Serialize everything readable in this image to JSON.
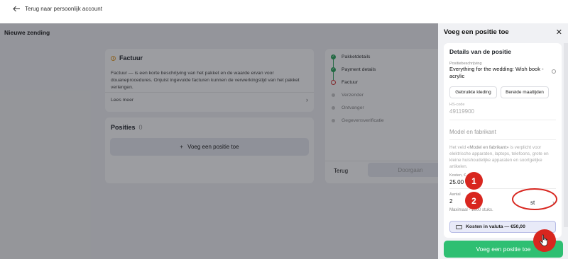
{
  "topbar": {
    "back_label": "Terug naar persoonlijk account"
  },
  "page": {
    "title": "Nieuwe zending"
  },
  "factuur": {
    "title": "Factuur",
    "description": "Factuur — is een korte beschrijving van het pakket en de waarde ervan voor douaneprocedures. Onjuist ingevulde facturen kunnen de verwerkingstijd van het pakket verlengen.",
    "read_more": "Lees meer"
  },
  "posities": {
    "title": "Posities",
    "count": "0",
    "add_label": "Voeg een positie toe"
  },
  "steps": {
    "items": [
      {
        "label": "Pakketdetails",
        "state": "done"
      },
      {
        "label": "Payment details",
        "state": "done"
      },
      {
        "label": "Factuur",
        "state": "current"
      },
      {
        "label": "Verzender",
        "state": "todo"
      },
      {
        "label": "Ontvanger",
        "state": "todo"
      },
      {
        "label": "Gegevensverificatie",
        "state": "todo"
      }
    ],
    "back_label": "Terug",
    "continue_label": "Doorgaan"
  },
  "panel": {
    "title": "Voeg een positie toe",
    "section_title": "Details van de positie",
    "description_label": "Positiebeschrijving",
    "description_value": "Everything for the wedding: Wish book - acrylic",
    "chips": [
      "Gebruikte kleding",
      "Bereide maaltijden"
    ],
    "hs_label": "HS-code",
    "hs_value": "49119900",
    "model_placeholder": "Model en fabrikant",
    "notice_prefix": "Het veld ",
    "notice_highlight": "«Model en fabrikant»",
    "notice_suffix": " is verplicht voor elektrische apparaten, laptops, telefoons, grote en kleine huishoudelijke apparaten en soortgelijke artikelen.",
    "cost_label": "Kosten, €",
    "cost_value": "25.00",
    "qty_label": "Aantal",
    "qty_value": "2",
    "unit_value": "st",
    "max_note": "Maximaal - 1000 stuks.",
    "currency_box": "Kosten in valuta — €50,00",
    "submit_label": "Voeg een positie toe"
  },
  "annotations": {
    "badge1": "1",
    "badge2": "2"
  },
  "colors": {
    "accent_green": "#2ebf72",
    "annotation_red": "#d8261f",
    "step_done": "#2ea55c"
  }
}
